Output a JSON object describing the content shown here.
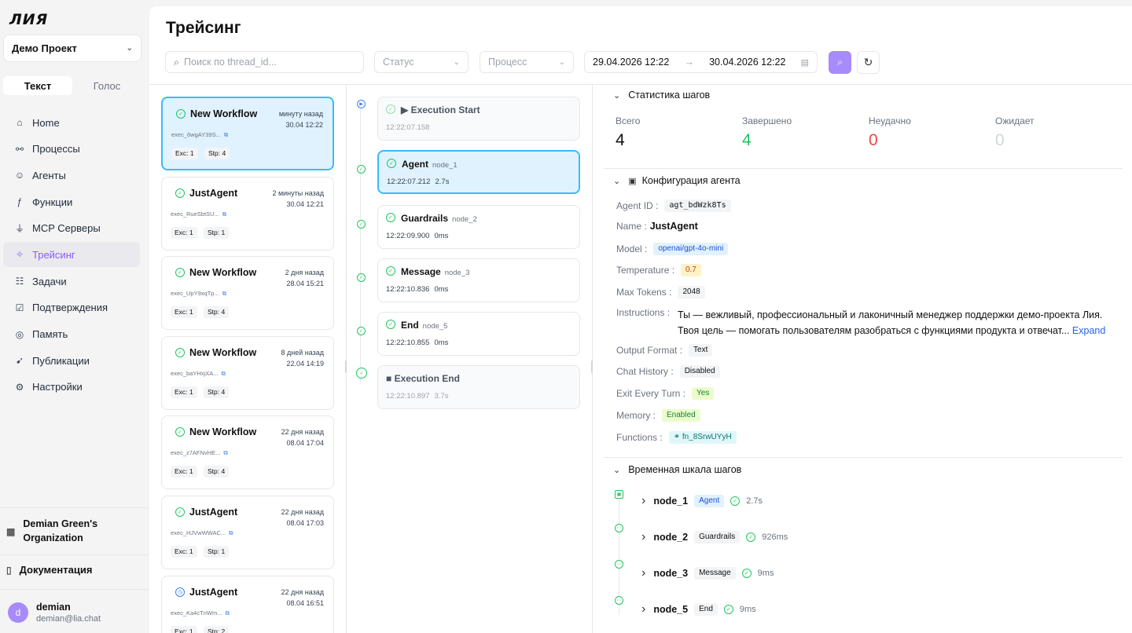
{
  "sidebar": {
    "logo": "ЛИЯ",
    "project": "Демо Проект",
    "modes": [
      "Текст",
      "Голос"
    ],
    "nav": [
      {
        "label": "Home",
        "icon": "home-icon",
        "glyph": "⌂"
      },
      {
        "label": "Процессы",
        "icon": "workflow-icon",
        "glyph": "⚯"
      },
      {
        "label": "Агенты",
        "icon": "bot-icon",
        "glyph": "☺"
      },
      {
        "label": "Функции",
        "icon": "function-icon",
        "glyph": "ƒ"
      },
      {
        "label": "MCP Серверы",
        "icon": "plug-icon",
        "glyph": "⏚"
      },
      {
        "label": "Трейсинг",
        "icon": "sparkle-icon",
        "glyph": "✧",
        "active": true
      },
      {
        "label": "Задачи",
        "icon": "list-icon",
        "glyph": "☷"
      },
      {
        "label": "Подтверждения",
        "icon": "check-square-icon",
        "glyph": "☑"
      },
      {
        "label": "Память",
        "icon": "database-icon",
        "glyph": "◎"
      },
      {
        "label": "Публикации",
        "icon": "rocket-icon",
        "glyph": "➹"
      },
      {
        "label": "Настройки",
        "icon": "gear-icon",
        "glyph": "⚙"
      }
    ],
    "org_line1": "Demian Green's",
    "org_line2": "Organization",
    "docs": "Документация",
    "user_name": "demian",
    "user_email": "demian@lia.chat",
    "avatar": "d"
  },
  "header": {
    "title": "Трейсинг",
    "search_placeholder": "Поиск по thread_id...",
    "status_placeholder": "Статус",
    "process_placeholder": "Процесс",
    "date_from": "29.04.2026 12:22",
    "date_to": "30.04.2026 12:22"
  },
  "executions": [
    {
      "name": "New Workflow",
      "ago": "минуту назад",
      "date": "30.04 12:22",
      "id": "exec_6wgAY39S...",
      "exc": "Exc: 1",
      "stp": "Stp: 4"
    },
    {
      "name": "JustAgent",
      "ago": "2 минуты назад",
      "date": "30.04 12:21",
      "id": "exec_RueSbtSU...",
      "exc": "Exc: 1",
      "stp": "Stp: 1"
    },
    {
      "name": "New Workflow",
      "ago": "2 дня назад",
      "date": "28.04 15:21",
      "id": "exec_UpY9xqTp...",
      "exc": "Exc: 1",
      "stp": "Stp: 4"
    },
    {
      "name": "New Workflow",
      "ago": "8 дней назад",
      "date": "22.04 14:19",
      "id": "exec_baYHxjXA...",
      "exc": "Exc: 1",
      "stp": "Stp: 4"
    },
    {
      "name": "New Workflow",
      "ago": "22 дня назад",
      "date": "08.04 17:04",
      "id": "exec_z7AFNvHE...",
      "exc": "Exc: 1",
      "stp": "Stp: 4"
    },
    {
      "name": "JustAgent",
      "ago": "22 дня назад",
      "date": "08.04 17:03",
      "id": "exec_HJVwWWAC...",
      "exc": "Exc: 1",
      "stp": "Stp: 1"
    },
    {
      "name": "JustAgent",
      "ago": "22 дня назад",
      "date": "08.04 16:51",
      "id": "exec_Ka4cTnWm...",
      "exc": "Exc: 1",
      "stp": "Stp: 2"
    }
  ],
  "nodes": [
    {
      "name": "▶ Execution Start",
      "time": "12:22:07.158"
    },
    {
      "name": "Agent",
      "id": "node_1",
      "time": "12:22:07.212",
      "dur": "2.7s"
    },
    {
      "name": "Guardrails",
      "id": "node_2",
      "time": "12:22:09.900",
      "dur": "0ms"
    },
    {
      "name": "Message",
      "id": "node_3",
      "time": "12:22:10.836",
      "dur": "0ms"
    },
    {
      "name": "End",
      "id": "node_5",
      "time": "12:22:10.855",
      "dur": "0ms"
    },
    {
      "name": "■ Execution End",
      "time": "12:22:10.897",
      "dur": "3.7s"
    }
  ],
  "stats": {
    "title": "Статистика шагов",
    "items": [
      {
        "label": "Всего",
        "value": "4",
        "color": "#111111"
      },
      {
        "label": "Завершено",
        "value": "4",
        "color": "#22c55e"
      },
      {
        "label": "Неудачно",
        "value": "0",
        "color": "#ef4444"
      },
      {
        "label": "Ожидает",
        "value": "0",
        "color": "#d1d5db"
      }
    ]
  },
  "config": {
    "title": "Конфигурация агента",
    "agent_id_label": "Agent ID :",
    "agent_id": "agt_bdWzk8Ts",
    "name_label": "Name :",
    "name": "JustAgent",
    "model_label": "Model :",
    "model": "openai/gpt-4o-mini",
    "temperature_label": "Temperature :",
    "temperature": "0.7",
    "max_tokens_label": "Max Tokens :",
    "max_tokens": "2048",
    "instructions_label": "Instructions :",
    "instructions_1": "Ты — вежливый, профессиональный и лаконичный менеджер поддержки демо-проекта Лия.",
    "instructions_2": "Твоя цель — помогать пользователям разобраться с функциями продукта и отвечат...",
    "expand": "Expand",
    "output_format_label": "Output Format :",
    "output_format": "Text",
    "chat_history_label": "Chat History :",
    "chat_history": "Disabled",
    "exit_every_turn_label": "Exit Every Turn :",
    "exit_every_turn": "Yes",
    "memory_label": "Memory :",
    "memory": "Enabled",
    "functions_label": "Functions :",
    "functions": "fn_8SrwUYyH"
  },
  "timeline": {
    "title": "Временная шкала шагов",
    "rows": [
      {
        "node": "node_1",
        "type": "Agent",
        "dur": "2.7s"
      },
      {
        "node": "node_2",
        "type": "Guardrails",
        "dur": "926ms"
      },
      {
        "node": "node_3",
        "type": "Message",
        "dur": "9ms"
      },
      {
        "node": "node_5",
        "type": "End",
        "dur": "9ms"
      }
    ]
  },
  "colors": {
    "accent": "#a78bfa",
    "selected_border": "#38bdf8",
    "success": "#22c55e"
  }
}
